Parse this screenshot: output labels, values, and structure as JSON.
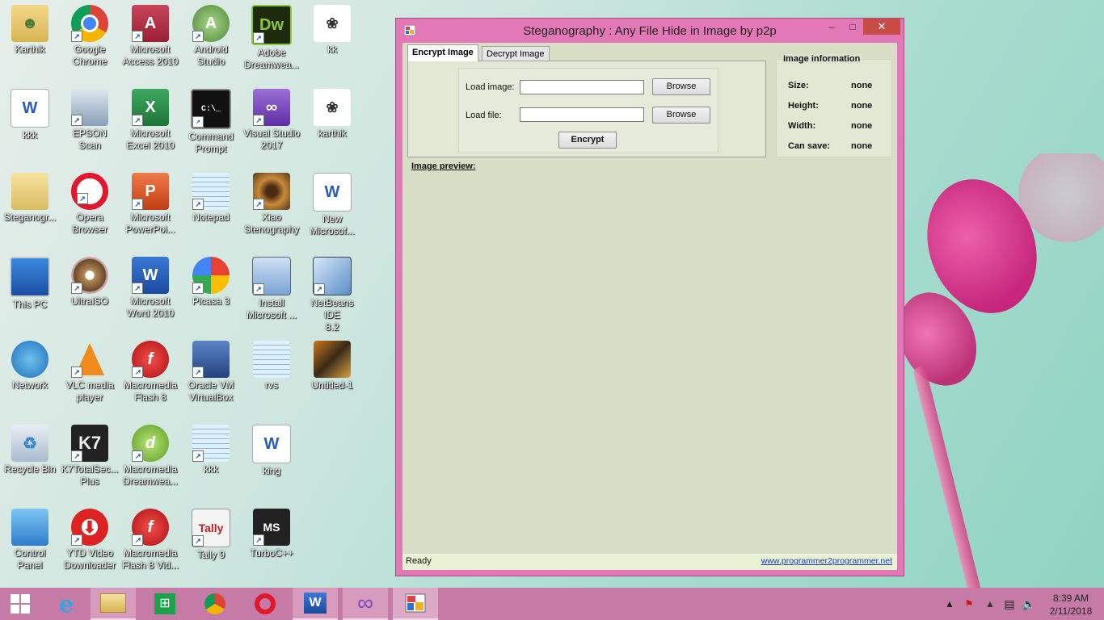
{
  "desktop": {
    "icons": [
      {
        "label": "Karthik"
      },
      {
        "label": "Google\nChrome"
      },
      {
        "label": "Microsoft\nAccess 2010"
      },
      {
        "label": "Android\nStudio"
      },
      {
        "label": "Adobe\nDreamwea..."
      },
      {
        "label": "kk"
      },
      {
        "label": "kkk"
      },
      {
        "label": "EPSON Scan"
      },
      {
        "label": "Microsoft\nExcel 2010"
      },
      {
        "label": "Command\nPrompt"
      },
      {
        "label": "Visual Studio\n2017"
      },
      {
        "label": "karthik"
      },
      {
        "label": "Steganogr..."
      },
      {
        "label": "Opera\nBrowser"
      },
      {
        "label": "Microsoft\nPowerPoi..."
      },
      {
        "label": "Notepad"
      },
      {
        "label": "Xiao\nStenography"
      },
      {
        "label": "New\nMicrosof..."
      },
      {
        "label": "This PC"
      },
      {
        "label": "UltraISO"
      },
      {
        "label": "Microsoft\nWord 2010"
      },
      {
        "label": "Picasa 3"
      },
      {
        "label": "Install\nMicrosoft ..."
      },
      {
        "label": "NetBeans IDE\n8.2"
      },
      {
        "label": "Network"
      },
      {
        "label": "VLC media\nplayer"
      },
      {
        "label": "Macromedia\nFlash 8"
      },
      {
        "label": "Oracle VM\nVirtualBox"
      },
      {
        "label": "rvs"
      },
      {
        "label": "Untitled-1"
      },
      {
        "label": "Recycle Bin"
      },
      {
        "label": "K7TotalSec...\nPlus"
      },
      {
        "label": "Macromedia\nDreamwea..."
      },
      {
        "label": "kkk"
      },
      {
        "label": "king"
      },
      {
        "label": "Control\nPanel"
      },
      {
        "label": "YTD Video\nDownloader"
      },
      {
        "label": "Macromedia\nFlash 8 Vid..."
      },
      {
        "label": "Tally 9"
      },
      {
        "label": "TurboC++"
      }
    ]
  },
  "window": {
    "title": "Steganography : Any File Hide in Image by p2p",
    "controls": {
      "minimize": "–",
      "maximize": "□",
      "close": "✕"
    },
    "tabs": [
      {
        "label": "Encrypt Image",
        "active": true
      },
      {
        "label": "Decrypt Image",
        "active": false
      }
    ],
    "encrypt": {
      "load_image_label": "Load image:",
      "load_image_value": "",
      "load_file_label": "Load file:",
      "load_file_value": "",
      "browse_label": "Browse",
      "encrypt_label": "Encrypt"
    },
    "info": {
      "title": "Image information",
      "rows": [
        {
          "label": "Size:",
          "value": "none"
        },
        {
          "label": "Height:",
          "value": "none"
        },
        {
          "label": "Width:",
          "value": "none"
        },
        {
          "label": "Can save:",
          "value": "none"
        }
      ]
    },
    "preview_label": "Image preview:",
    "status": {
      "text": "Ready",
      "link": "www.programmer2programmer.net"
    }
  },
  "taskbar": {
    "clock_time": "8:39 AM",
    "clock_date": "2/11/2018"
  },
  "colors": {
    "window_border": "#e278b6",
    "client_bg": "#d7dec5",
    "taskbar": "#c67aa6",
    "close": "#c74c45"
  }
}
